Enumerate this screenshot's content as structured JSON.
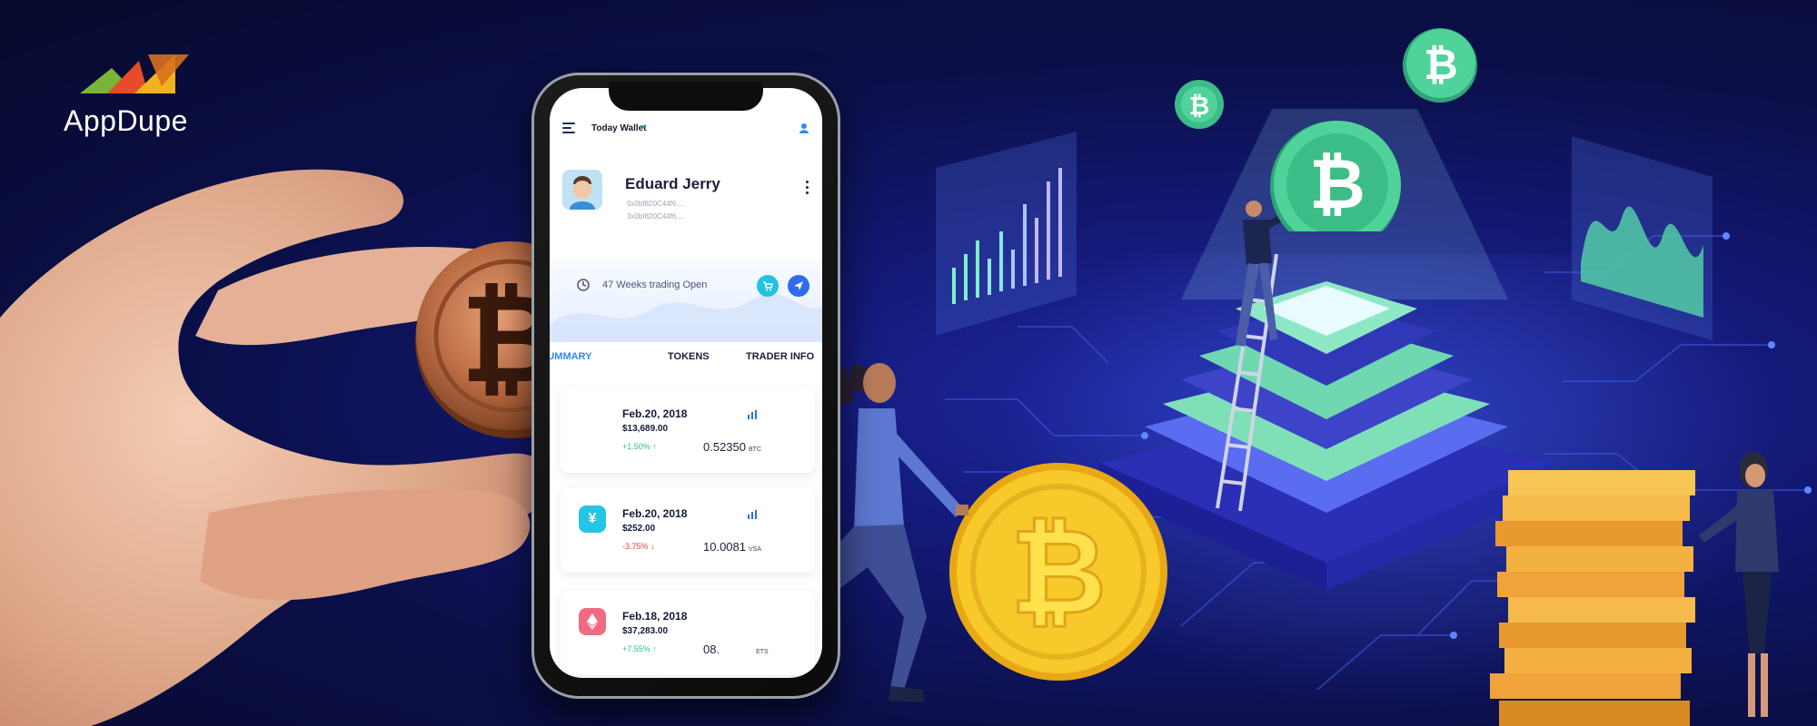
{
  "brand": {
    "name": "AppDupe",
    "colors": [
      "#78b53a",
      "#e64b2a",
      "#f2b21e"
    ]
  },
  "wallet": {
    "title": "Today Wallet",
    "user": {
      "name": "Eduard Jerry",
      "address_1": "0x0bf820C44f6....",
      "address_2": "3x0bf820C44f6...."
    },
    "trading_status": "47 Weeks trading Open",
    "tabs": [
      {
        "label": "SUMMARY",
        "active": true
      },
      {
        "label": "TOKENS",
        "active": false
      },
      {
        "label": "TRADER INFO",
        "active": false
      }
    ],
    "transactions": [
      {
        "date": "Feb.20, 2018",
        "price": "$13,689.00",
        "change": "+1.50%",
        "direction": "up",
        "amount": "0.52350",
        "unit": "BTC",
        "icon": "bitcoin-icon"
      },
      {
        "date": "Feb.20, 2018",
        "price": "$252.00",
        "change": "-3.75%",
        "direction": "down",
        "amount": "10.0081",
        "unit": "VSA",
        "icon": "yen-icon"
      },
      {
        "date": "Feb.18, 2018",
        "price": "$37,283.00",
        "change": "+7.55%",
        "direction": "up",
        "amount": "08.",
        "unit": "ETS",
        "icon": "ethereum-icon"
      }
    ]
  },
  "illustration": {
    "coin_symbol": "₿",
    "colors": {
      "bronze_coin": "#b86a3c",
      "gold_coin": "#f7c92a",
      "green_coin": "#4fd39a",
      "background": "#0b0f49"
    }
  }
}
